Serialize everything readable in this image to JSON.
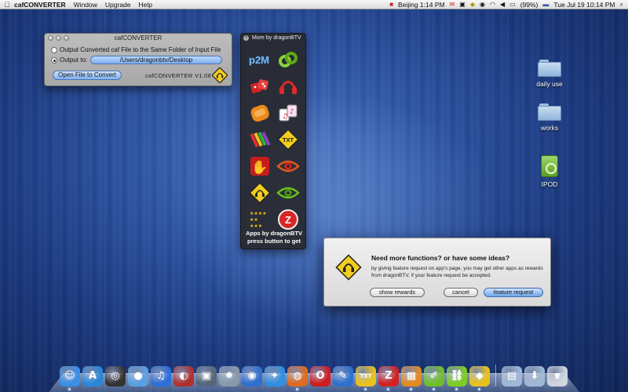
{
  "menubar": {
    "app_name": "cafCONVERTER",
    "menus": [
      "Window",
      "Upgrade",
      "Help"
    ],
    "clock_beijing": "Beijing 1:14 PM",
    "battery": "(99%)",
    "datetime": "Tue Jul 19  10:14 PM"
  },
  "caf_window": {
    "title": "cafCONVERTER",
    "option_same_folder": "Output Converted caf File to the Same Folder of Input File",
    "option_output_to": "Output to:",
    "output_path": "/Users/dragonbtv/Desktop",
    "open_button": "Open File to Convert",
    "version": "cafCONVERTER V1.08"
  },
  "more_panel": {
    "title": "More by dragonBTV",
    "footer_line1": "Apps by dragonBTV",
    "footer_line2": "press button to get",
    "apps": [
      {
        "icon": "p2m-app-icon",
        "label": "p2M"
      },
      {
        "icon": "green-chain-app-icon",
        "label": ""
      },
      {
        "icon": "red-dice-app-icon",
        "label": ""
      },
      {
        "icon": "red-headphones-app-icon",
        "label": ""
      },
      {
        "icon": "orange-pad-app-icon",
        "label": ""
      },
      {
        "icon": "music-cards-app-icon",
        "label": ""
      },
      {
        "icon": "color-crayons-app-icon",
        "label": ""
      },
      {
        "icon": "txt-sign-app-icon",
        "label": "TXT"
      },
      {
        "icon": "red-hand-app-icon",
        "label": ""
      },
      {
        "icon": "red-eye-app-icon",
        "label": ""
      },
      {
        "icon": "headphone-sign-app-icon",
        "label": ""
      },
      {
        "icon": "green-eye-app-icon",
        "label": ""
      },
      {
        "icon": "star-rating-app-icon",
        "label": "★★★★\n★★\n★★★"
      },
      {
        "icon": "z-logo-app-icon",
        "label": "Z"
      }
    ]
  },
  "desktop_icons": [
    {
      "label": "daily use",
      "type": "folder"
    },
    {
      "label": "works",
      "type": "folder"
    },
    {
      "label": "IPOD",
      "type": "ipod"
    }
  ],
  "dialog": {
    "heading": "Need more functions? or have some ideas?",
    "body": "by giving feature request on app's page, you may get other apps as rewards from dragonBTV, if your feature request be accepted.",
    "btn_rewards": "show rewards",
    "btn_cancel": "cancel",
    "btn_request": "feature request"
  },
  "dock": [
    {
      "name": "finder-icon",
      "glyph": "☺",
      "color": "#3a8ee6",
      "running": true
    },
    {
      "name": "app-store-icon",
      "glyph": "A",
      "color": "#2a86d8",
      "running": false
    },
    {
      "name": "dashboard-icon",
      "glyph": "◎",
      "color": "#333333",
      "running": false
    },
    {
      "name": "ichat-icon",
      "glyph": "●",
      "color": "#5aa0e0",
      "running": false
    },
    {
      "name": "itunes-icon",
      "glyph": "♫",
      "color": "#2c6fd6",
      "running": false
    },
    {
      "name": "dvd-player-icon",
      "glyph": "◐",
      "color": "#b03030",
      "running": false
    },
    {
      "name": "preview-icon",
      "glyph": "▣",
      "color": "#556677",
      "running": false
    },
    {
      "name": "system-preferences-icon",
      "glyph": "✹",
      "color": "#8899aa",
      "running": false
    },
    {
      "name": "google-earth-icon",
      "glyph": "◉",
      "color": "#2f6fcf",
      "running": false
    },
    {
      "name": "safari-icon",
      "glyph": "✦",
      "color": "#2f8fe0",
      "running": false
    },
    {
      "name": "firefox-icon",
      "glyph": "◍",
      "color": "#e06a1f",
      "running": true
    },
    {
      "name": "opera-icon",
      "glyph": "O",
      "color": "#d01d1d",
      "running": false
    },
    {
      "name": "xcode-icon",
      "glyph": "✎",
      "color": "#2e70d0",
      "running": false
    },
    {
      "name": "txt-app-icon",
      "glyph": "TXT",
      "color": "#e8c21a",
      "running": true
    },
    {
      "name": "z-app-icon",
      "glyph": "Z",
      "color": "#d42020",
      "running": true
    },
    {
      "name": "orange-pad-icon",
      "glyph": "▩",
      "color": "#e38a1f",
      "running": true
    },
    {
      "name": "crayons-icon",
      "glyph": "✐",
      "color": "#6fbf2a",
      "running": true
    },
    {
      "name": "chain-icon",
      "glyph": "⛓",
      "color": "#7fcc23",
      "running": true
    },
    {
      "name": "headphone-sign-icon",
      "glyph": "◆",
      "color": "#e8c21a",
      "running": true
    }
  ],
  "dock_right": [
    {
      "name": "applications-stack-icon",
      "glyph": "▤",
      "color": "#9fb8d6"
    },
    {
      "name": "downloads-stack-icon",
      "glyph": "⬇",
      "color": "#9fb8d6"
    },
    {
      "name": "trash-icon",
      "glyph": "🗑",
      "color": "#cfd6de"
    }
  ]
}
